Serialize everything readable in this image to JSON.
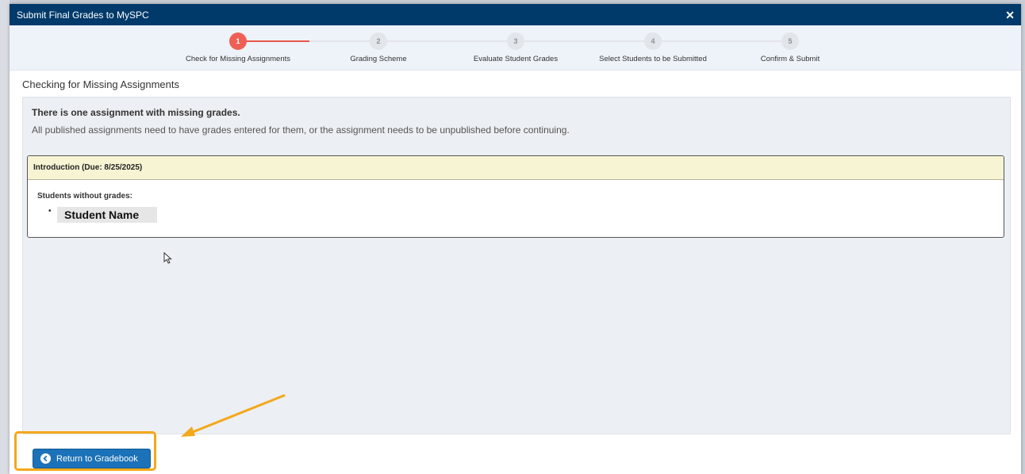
{
  "modal": {
    "title": "Submit Final Grades to MySPC",
    "close_glyph": "✕"
  },
  "stepper": {
    "steps": [
      {
        "number": "1",
        "label": "Check for Missing Assignments",
        "active": true
      },
      {
        "number": "2",
        "label": "Grading Scheme",
        "active": false
      },
      {
        "number": "3",
        "label": "Evaluate Student Grades",
        "active": false
      },
      {
        "number": "4",
        "label": "Select Students to be Submitted",
        "active": false
      },
      {
        "number": "5",
        "label": "Confirm & Submit",
        "active": false
      }
    ]
  },
  "section": {
    "title": "Checking for Missing Assignments"
  },
  "panel": {
    "heading": "There is one assignment with missing grades.",
    "description": "All published assignments need to have grades entered for them, or the assignment needs to be unpublished before continuing."
  },
  "assignment": {
    "header": "Introduction (Due: 8/25/2025)",
    "sub_label": "Students without grades:",
    "bullet": "•",
    "students": [
      "Student Name"
    ]
  },
  "footer": {
    "return_label": "Return to Gradebook"
  },
  "colors": {
    "header_bg": "#003a6b",
    "step_active": "#ef5f55",
    "button_bg": "#1c72b8",
    "highlight": "#f3a81b",
    "assign_header_bg": "#f7f4d4"
  },
  "icons": {
    "close": "close-icon",
    "back": "chevron-left-circle-icon",
    "cursor": "mouse-cursor-icon",
    "annotation": "arrow-annotation-icon"
  }
}
